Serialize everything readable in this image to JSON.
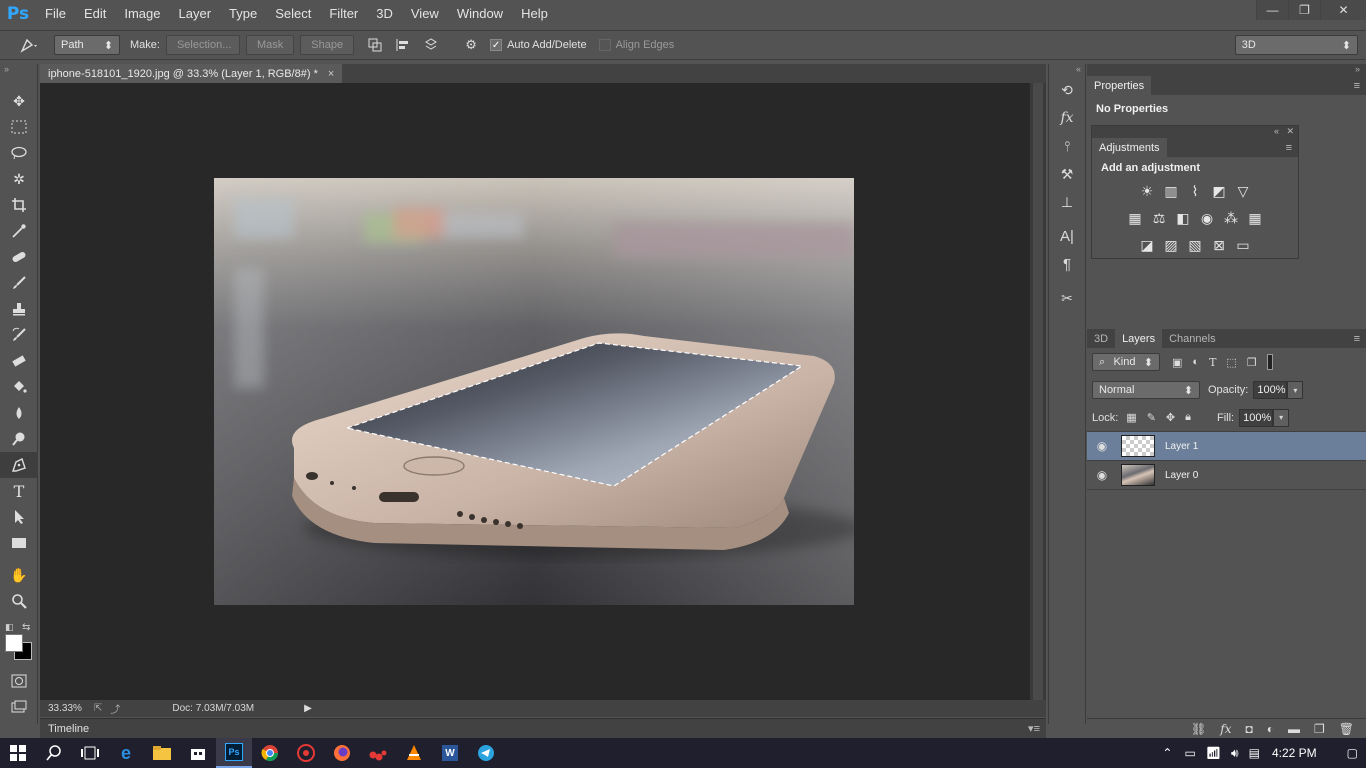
{
  "app": {
    "logo": "Ps"
  },
  "menu": [
    "File",
    "Edit",
    "Image",
    "Layer",
    "Type",
    "Select",
    "Filter",
    "3D",
    "View",
    "Window",
    "Help"
  ],
  "window_controls": {
    "minimize": "—",
    "restore": "❐",
    "close": "✕"
  },
  "options_bar": {
    "mode_value": "Path",
    "make_label": "Make:",
    "selection_btn": "Selection...",
    "mask_btn": "Mask",
    "shape_btn": "Shape",
    "auto_add_delete": "Auto Add/Delete",
    "auto_add_delete_checked": true,
    "align_edges": "Align Edges",
    "align_edges_checked": false,
    "workspace": "3D"
  },
  "document": {
    "tab_title": "iphone-518101_1920.jpg @ 33.3% (Layer 1, RGB/8#) *",
    "close": "×",
    "zoom": "33.33%",
    "doc_info": "Doc: 7.03M/7.03M"
  },
  "timeline": {
    "label": "Timeline"
  },
  "tools": [
    "move-icon",
    "marquee-icon",
    "lasso-icon",
    "magic-wand-icon",
    "crop-icon",
    "eyedropper-icon",
    "healing-icon",
    "brush-icon",
    "stamp-icon",
    "history-brush-icon",
    "eraser-icon",
    "bucket-icon",
    "dodge-icon",
    "blur-icon",
    "pen-icon",
    "type-icon",
    "path-select-icon",
    "rectangle-icon",
    "hand-icon",
    "zoom-icon"
  ],
  "properties": {
    "tab": "Properties",
    "content": "No Properties"
  },
  "adjustments": {
    "tab": "Adjustments",
    "title": "Add an adjustment"
  },
  "layers_panel": {
    "tabs": [
      "3D",
      "Layers",
      "Channels"
    ],
    "active_tab": "Layers",
    "filter_kind": "Kind",
    "blend_mode": "Normal",
    "opacity_label": "Opacity:",
    "opacity_value": "100%",
    "lock_label": "Lock:",
    "fill_label": "Fill:",
    "fill_value": "100%",
    "layers": [
      {
        "name": "Layer 1",
        "selected": true
      },
      {
        "name": "Layer 0",
        "selected": false
      }
    ]
  },
  "taskbar": {
    "time": "4:22 PM"
  },
  "colors": {
    "accent": "#31a8ff",
    "selected_layer": "#6c7f9a"
  }
}
